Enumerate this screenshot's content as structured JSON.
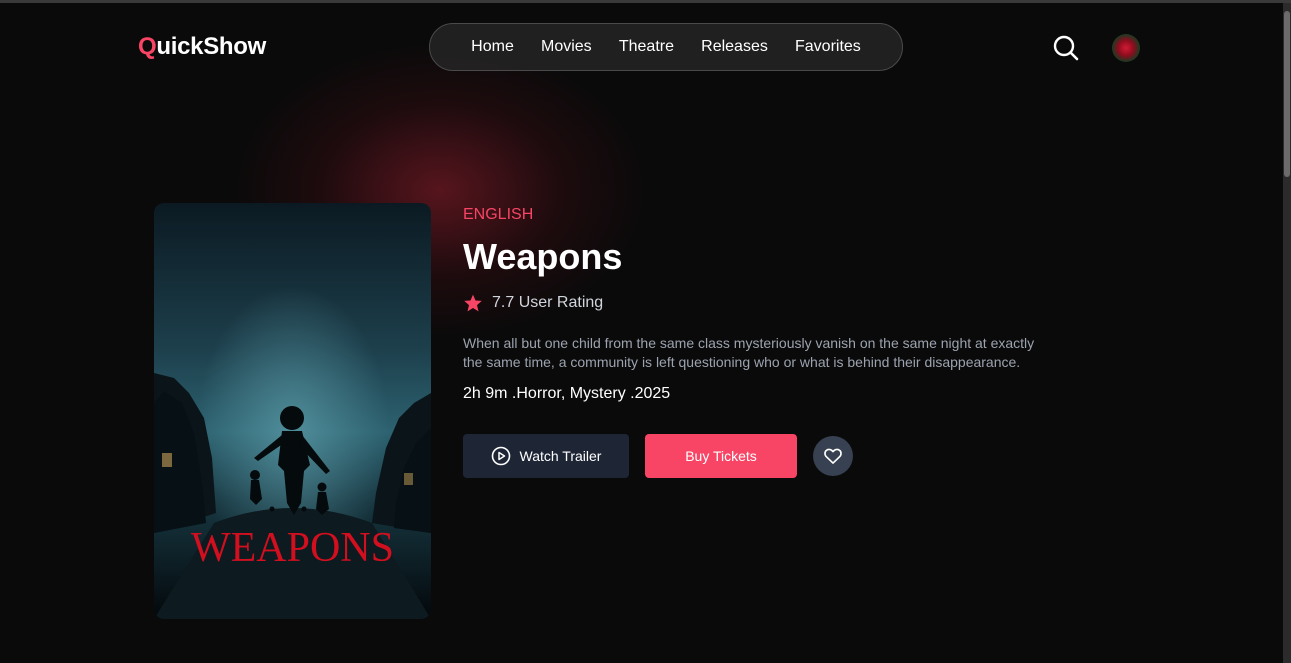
{
  "header": {
    "logo_initial": "Q",
    "logo_rest": "uickShow",
    "nav": [
      "Home",
      "Movies",
      "Theatre",
      "Releases",
      "Favorites"
    ],
    "search_icon": "search-icon",
    "avatar_icon": "user-avatar"
  },
  "movie": {
    "language": "ENGLISH",
    "title": "Weapons",
    "rating": "7.7 User Rating",
    "description": "When all but one child from the same class mysteriously vanish on the same night at exactly the same time, a community is left questioning who or what is behind their disappearance.",
    "meta": "2h 9m .Horror, Mystery .2025",
    "poster_text": "WEAPONS"
  },
  "actions": {
    "trailer_label": "Watch Trailer",
    "buy_label": "Buy Tickets",
    "favorite_icon": "heart-icon"
  },
  "colors": {
    "accent": "#f84565",
    "background": "#0a0a0a",
    "secondary_button": "#1e2636"
  }
}
